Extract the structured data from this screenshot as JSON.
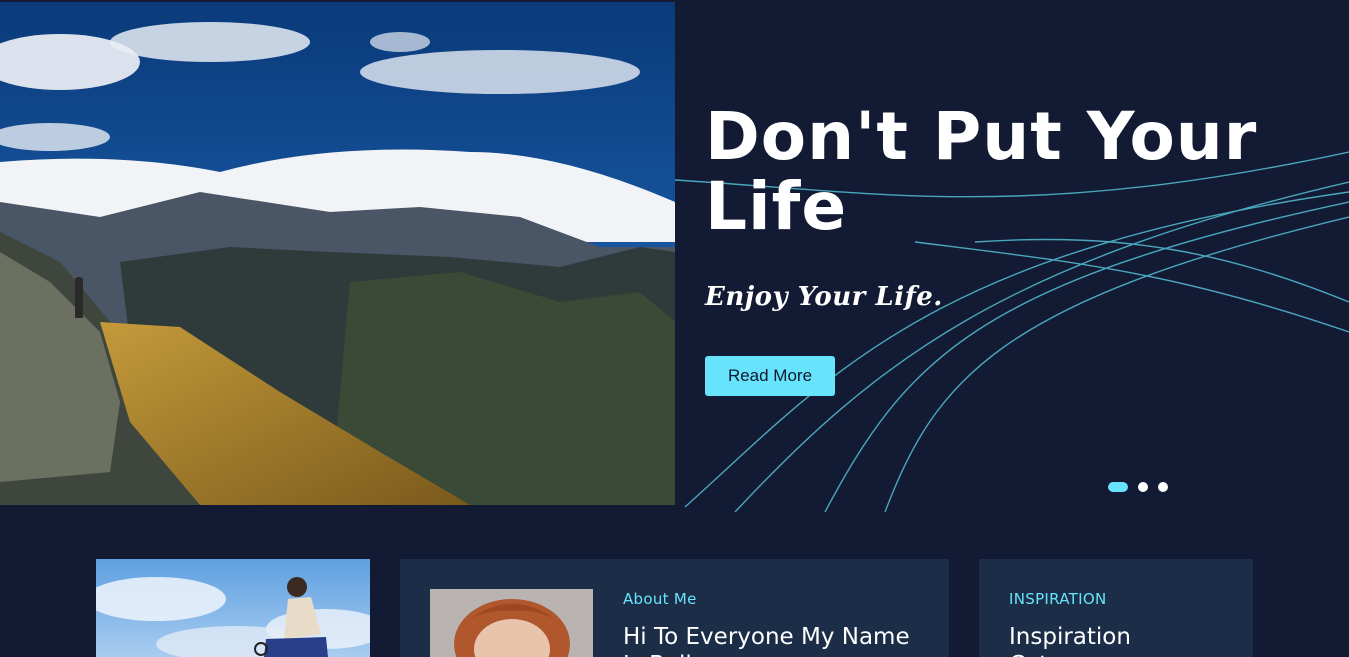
{
  "hero": {
    "title": "Don't Put Your Life",
    "tagline": "Enjoy Your Life.",
    "button_label": "Read More",
    "accent_color": "#67e3fb",
    "background_color": "#121b33",
    "slides": {
      "count": 3,
      "active_index": 0
    }
  },
  "cards": {
    "about": {
      "label": "About Me",
      "heading": "Hi To Everyone My Name Is Bella"
    },
    "inspiration": {
      "label": "Inspiration",
      "heading": "Inspiration Category"
    }
  },
  "icons": {
    "hero_image": "mountain-landscape-photo",
    "card_photo": "cyclist-sky-photo",
    "about_photo": "woman-portrait-photo"
  }
}
